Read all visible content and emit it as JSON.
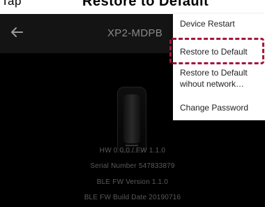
{
  "caption": {
    "left_text": "Tap",
    "title": "Restore to Default"
  },
  "app": {
    "device_name": "XP2-MDPB",
    "info": {
      "hw_fw": "HW 0.0.0 / FW 1.1.0",
      "serial": "Serial Number 547833879",
      "ble_fw": "BLE FW Version 1.1.0",
      "ble_build": "BLE FW Build Date 20190716"
    }
  },
  "menu": {
    "items": [
      {
        "label": "Device Restart"
      },
      {
        "label": "Restore to Default"
      },
      {
        "label_line1": "Restore to Default",
        "label_line2": "wihout network…"
      },
      {
        "label": "Change Password"
      }
    ]
  },
  "colors": {
    "highlight": "#a3173d",
    "screen_bg": "#000000",
    "appbar_bg": "#141414"
  },
  "icons": {
    "back": "arrow-left-icon"
  }
}
